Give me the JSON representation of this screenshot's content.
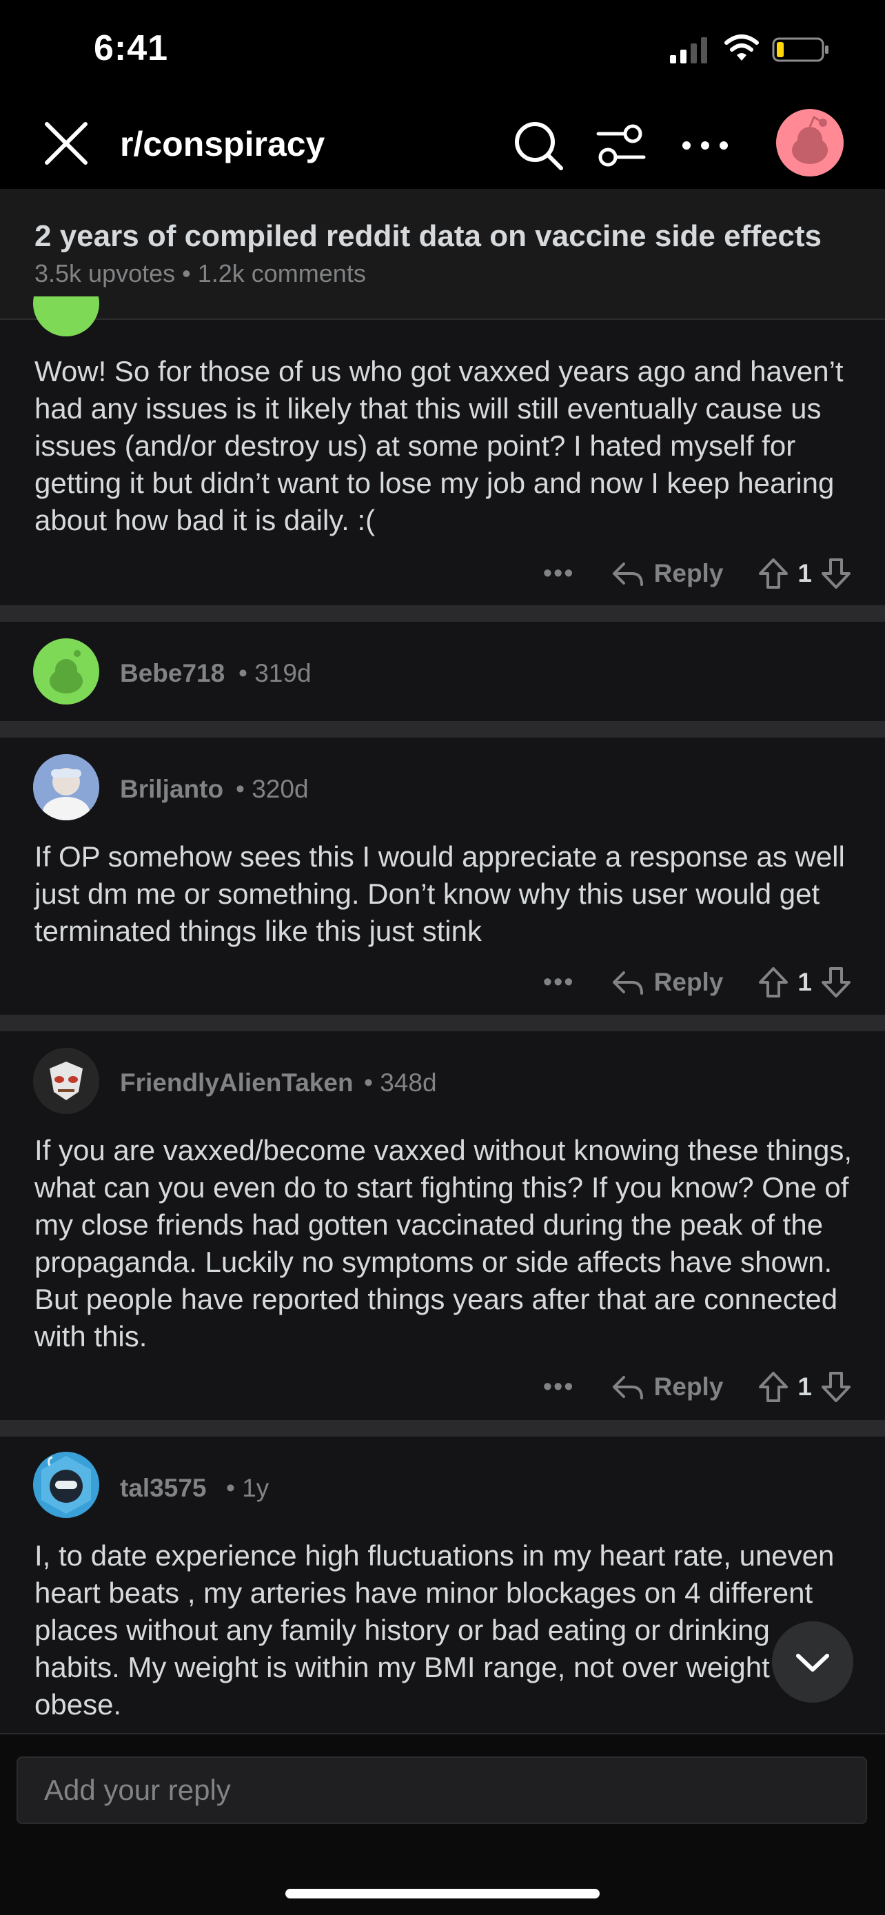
{
  "status_bar": {
    "time": "6:41"
  },
  "header": {
    "subreddit": "r/conspiracy"
  },
  "post": {
    "title": "2 years of compiled reddit data on vaccine side effects",
    "meta": "3.5k upvotes • 1.2k comments"
  },
  "comments": [
    {
      "text": "Wow! So for those of us who got vaxxed years ago and haven’t had any issues is it likely that this will still eventually cause us issues (and/or destroy us) at some point? I hated myself for getting it but didn’t want to lose my job and now I keep hearing about how bad it is daily. :(",
      "reply_label": "Reply",
      "votes": "1"
    },
    {
      "username": "Bebe718",
      "age": "• 319d",
      "avatar_color": "#7ed957"
    },
    {
      "username": "Briljanto",
      "age": "• 320d",
      "text": "If OP somehow sees this I would appreciate a response as well just dm me or something. Don’t know why this user would get terminated things like this just stink",
      "reply_label": "Reply",
      "votes": "1"
    },
    {
      "username": "FriendlyAlienTaken",
      "age": "• 348d",
      "text": "If you are vaxxed/become vaxxed without knowing these things, what can you even do to start fighting this? If you know? One of my close friends had gotten vaccinated during the peak of the propaganda. Luckily no symptoms or side affects have shown. But people have reported things years after that are connected with this.",
      "reply_label": "Reply",
      "votes": "1"
    },
    {
      "username": "tal3575",
      "age": "• 1y",
      "text": "I, to date experience high fluctuations in my heart rate, uneven heart beats , my arteries have minor blockages on 4 different places without any family history or bad eating or drinking habits. My weight is within my BMI range, not over weight or obese."
    }
  ],
  "reply_bar": {
    "placeholder": "Add your reply"
  },
  "icons": {
    "close": "close-icon",
    "search": "search-icon",
    "filter": "filter-icon",
    "more": "more-icon",
    "reply": "reply-arrow-icon",
    "upvote": "upvote-icon",
    "downvote": "downvote-icon",
    "scroll": "chevron-down-icon"
  },
  "colors": {
    "background": "#000000",
    "card": "#141416",
    "muted_text": "#818384",
    "snoo_green": "#7ed957",
    "avatar_pink": "#ff8a95"
  }
}
